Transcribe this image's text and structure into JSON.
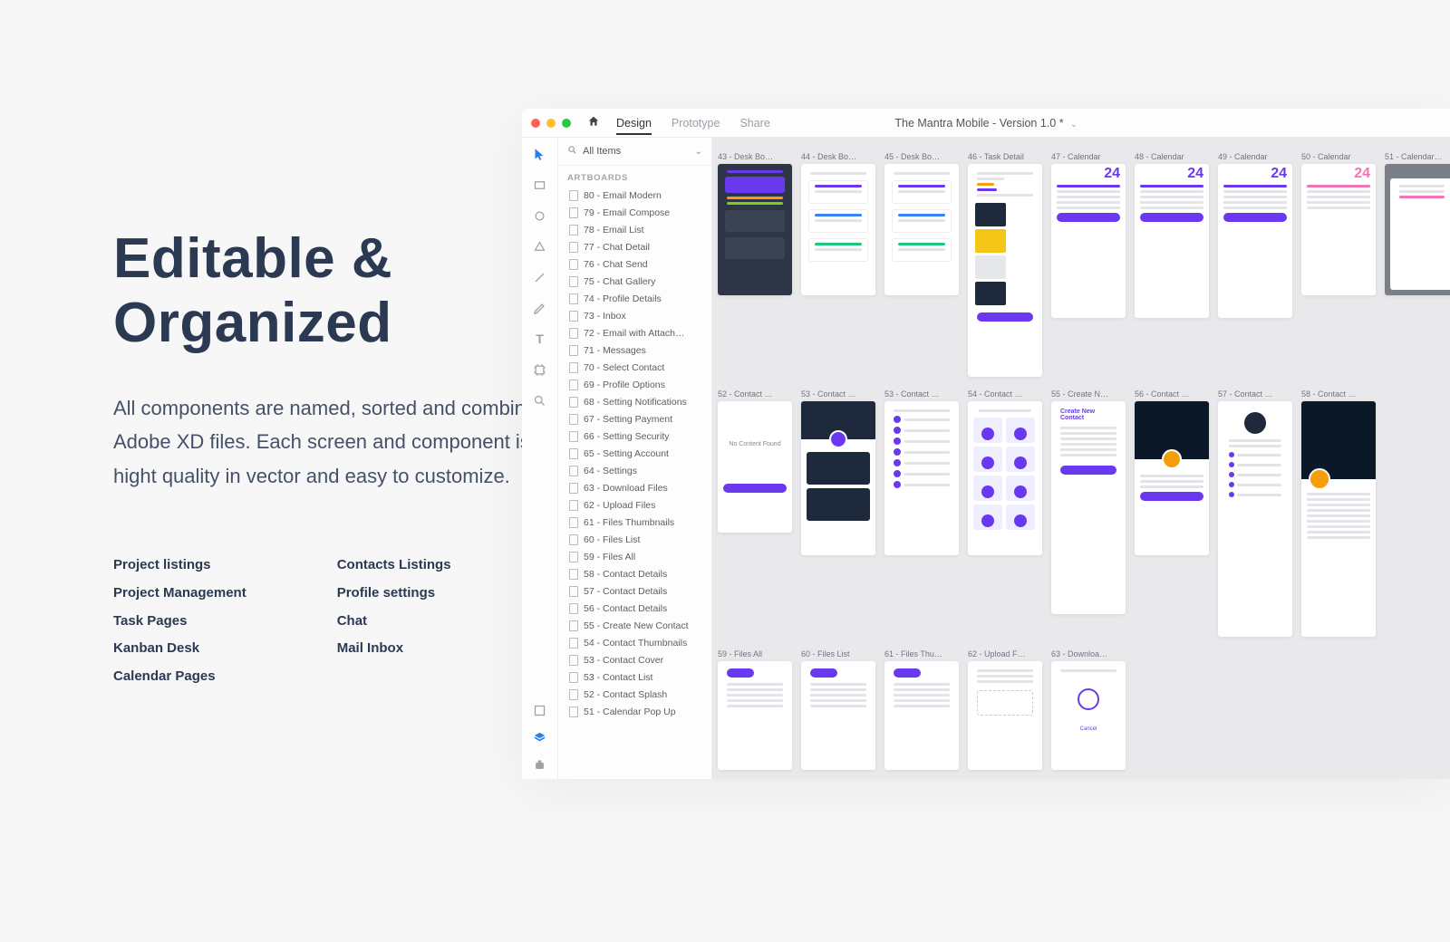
{
  "hero": {
    "title": "Editable  & Organized",
    "desc": "All components are named, sorted and combined in Adobe XD files. Each screen and component is made hight quality in vector and easy to customize.",
    "colA": [
      "Project listings",
      "Project Management",
      "Task Pages",
      "Kanban Desk",
      "Calendar Pages"
    ],
    "colB": [
      "Contacts Listings",
      "Profile settings",
      "Chat",
      "Mail Inbox"
    ]
  },
  "xd": {
    "tabs": {
      "design": "Design",
      "prototype": "Prototype",
      "share": "Share"
    },
    "docTitle": "The Mantra Mobile - Version 1.0 *",
    "search": "All Items",
    "panelHeader": "ARTBOARDS",
    "artboards": [
      "80 - Email Modern",
      "79 - Email Compose",
      "78 - Email List",
      "77 - Chat Detail",
      "76 - Chat Send",
      "75 - Chat Gallery",
      "74 - Profile Details",
      "73 - Inbox",
      "72 - Email with Attach…",
      "71 - Messages",
      "70 - Select Contact",
      "69 - Profile Options",
      "68 - Setting Notifications",
      "67 - Setting Payment",
      "66 - Setting Security",
      "65 - Setting Account",
      "64 - Settings",
      "63 - Download Files",
      "62 - Upload Files",
      "61 - Files Thumbnails",
      "60 - Files List",
      "59 - Files All",
      "58 - Contact Details",
      "57 - Contact Details",
      "56 - Contact Details",
      "55 - Create New Contact",
      "54 - Contact Thumbnails",
      "53 - Contact Cover",
      "53 - Contact List",
      "52 - Contact Splash",
      "51 - Calendar Pop Up"
    ],
    "row1": [
      {
        "label": "43 - Desk Bo…",
        "kind": "dark"
      },
      {
        "label": "44 - Desk Bo…",
        "kind": "cards"
      },
      {
        "label": "45 - Desk Bo…",
        "kind": "cards"
      },
      {
        "label": "46 - Task Detail",
        "kind": "task"
      },
      {
        "label": "47 - Calendar",
        "kind": "cal"
      },
      {
        "label": "48 - Calendar",
        "kind": "cal"
      },
      {
        "label": "49 - Calendar",
        "kind": "cal"
      },
      {
        "label": "50 - Calendar",
        "kind": "calpk"
      },
      {
        "label": "51 - Calendar…",
        "kind": "calpop"
      }
    ],
    "row2": [
      {
        "label": "52 - Contact …",
        "kind": "splash"
      },
      {
        "label": "53 - Contact …",
        "kind": "cover"
      },
      {
        "label": "53 - Contact …",
        "kind": "list"
      },
      {
        "label": "54 - Contact …",
        "kind": "thumbs"
      },
      {
        "label": "55 - Create N…",
        "kind": "form"
      },
      {
        "label": "56 - Contact …",
        "kind": "photo"
      },
      {
        "label": "57 - Contact …",
        "kind": "profile"
      },
      {
        "label": "58 - Contact …",
        "kind": "photoL"
      }
    ],
    "row3": [
      {
        "label": "59 - Files All",
        "kind": "files"
      },
      {
        "label": "60 - Files List",
        "kind": "files"
      },
      {
        "label": "61 - Files Thu…",
        "kind": "files"
      },
      {
        "label": "62 - Upload F…",
        "kind": "upload"
      },
      {
        "label": "63 - Downloa…",
        "kind": "download"
      }
    ]
  }
}
